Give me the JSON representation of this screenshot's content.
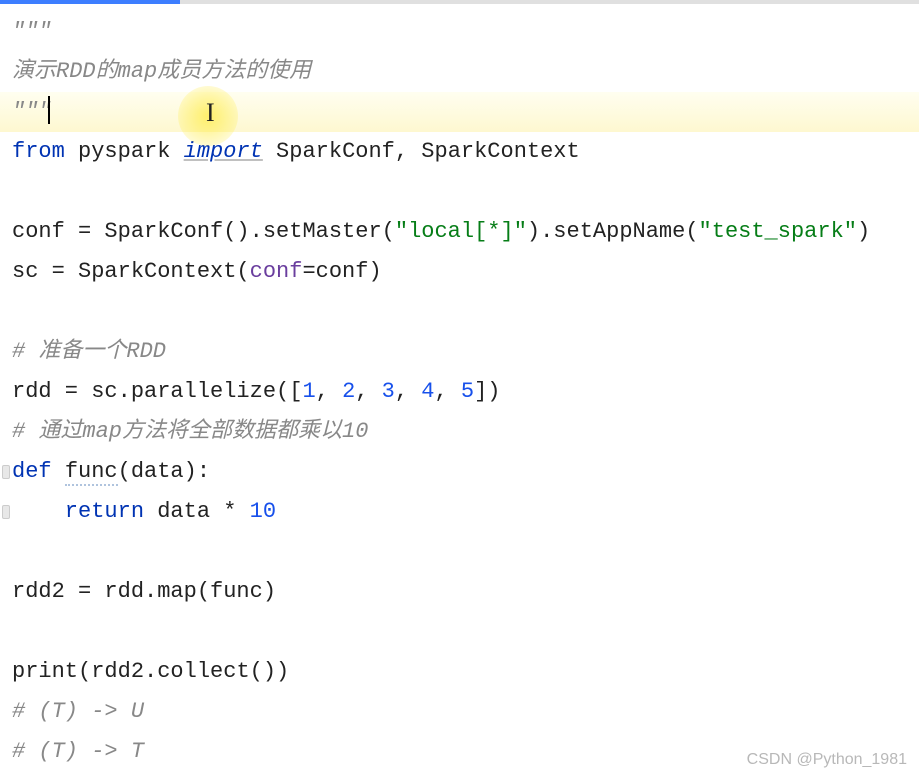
{
  "code": {
    "line1": "\"\"\"",
    "line2_pre": "演示",
    "line2_rdd": "RDD",
    "line2_de": "的",
    "line2_map": "map",
    "line2_post": "成员方法的使用",
    "line3": "\"\"\"",
    "line4_from": "from",
    "line4_pyspark": " pyspark ",
    "line4_import": "import",
    "line4_rest": " SparkConf, SparkContext",
    "line6_left": "conf = SparkConf().setMaster(",
    "line6_str1": "\"local[*]\"",
    "line6_mid": ").setAppName(",
    "line6_str2": "\"test_spark\"",
    "line6_right": ")",
    "line7_left": "sc = SparkContext(",
    "line7_param": "conf",
    "line7_rest": "=conf)",
    "line9_comment": "# 准备一个RDD",
    "line10_left": "rdd = sc.parallelize([",
    "line10_n1": "1",
    "line10_c1": ", ",
    "line10_n2": "2",
    "line10_c2": ", ",
    "line10_n3": "3",
    "line10_c3": ", ",
    "line10_n4": "4",
    "line10_c4": ", ",
    "line10_n5": "5",
    "line10_right": "])",
    "line11_comment": "# 通过map方法将全部数据都乘以10",
    "line12_def": "def ",
    "line12_func": "func",
    "line12_params": "(data):",
    "line13_return": "    return ",
    "line13_expr": "data * ",
    "line13_num": "10",
    "line15": "rdd2 = rdd.map(func)",
    "line17_print": "print",
    "line17_rest": "(rdd2.collect())",
    "line18": "# (T) -> U",
    "line19": "# (T) -> T"
  },
  "watermark": "CSDN @Python_1981"
}
